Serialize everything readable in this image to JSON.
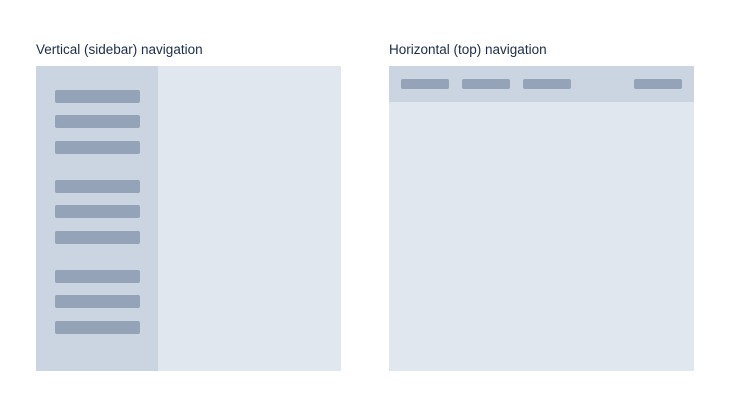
{
  "vertical": {
    "caption": "Vertical (sidebar) navigation",
    "nav_items": 9
  },
  "horizontal": {
    "caption": "Horizontal (top) navigation",
    "nav_items": 4
  },
  "colors": {
    "text": "#1b2c49",
    "content": "#e1e7ef",
    "nav_bar": "#cbd5e1",
    "nav_item": "#94a3b8"
  }
}
